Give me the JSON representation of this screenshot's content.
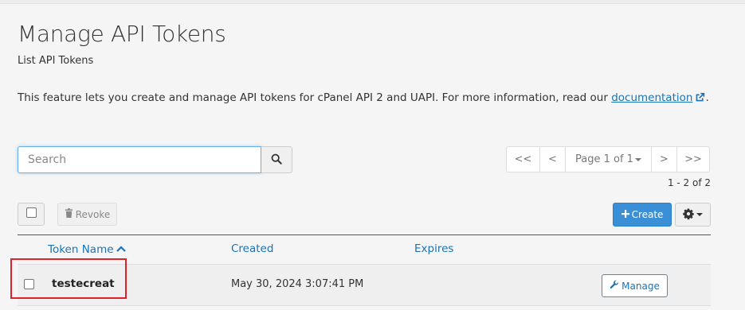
{
  "page": {
    "title": "Manage API Tokens",
    "subtitle": "List API Tokens",
    "description_prefix": "This feature lets you create and manage API tokens for cPanel API 2 and UAPI. For more information, read our ",
    "documentation_link": "documentation",
    "description_suffix": "."
  },
  "search": {
    "placeholder": "Search",
    "value": ""
  },
  "pagination": {
    "first": "<<",
    "prev": "<",
    "page_label": "Page 1 of 1",
    "next": ">",
    "last": ">>",
    "count": "1 - 2 of 2"
  },
  "toolbar": {
    "revoke_label": "Revoke",
    "create_label": "Create"
  },
  "table": {
    "columns": [
      "Token Name",
      "Created",
      "Expires"
    ],
    "rows": [
      {
        "name": "testecreat",
        "created": "May 30, 2024 3:07:41 PM",
        "expires": "",
        "action": "Manage"
      }
    ]
  },
  "colors": {
    "accent": "#3a8fd6",
    "link": "#1a73b5",
    "highlight": "#e0202a"
  },
  "icons": [
    "search-icon",
    "external-link-icon",
    "trash-icon",
    "plus-icon",
    "gear-icon",
    "sort-up-icon",
    "wrench-icon"
  ]
}
